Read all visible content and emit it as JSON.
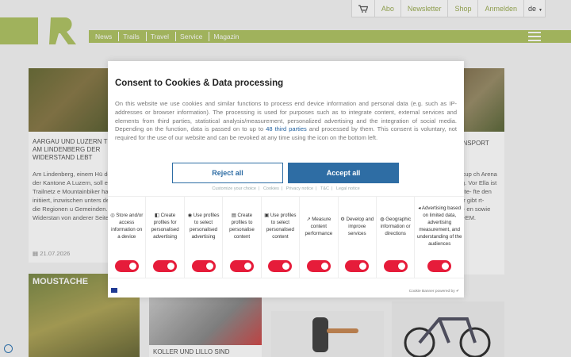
{
  "topbar": {
    "cart_icon": "cart-icon",
    "abo": "Abo",
    "newsletter": "Newsletter",
    "shop": "Shop",
    "login": "Anmelden",
    "lang": "de"
  },
  "nav": {
    "items": [
      "News",
      "Trails",
      "Travel",
      "Service",
      "Magazin"
    ],
    "menu_icon": "hamburger-menu-icon"
  },
  "articles": {
    "a1": {
      "title": "AARGAU UND LUZERN TRAILS AM LINDENBERG DER WIDERSTAND LEBT",
      "text": "Am Lindenberg, einem Hü der Grenze der Kantone A Luzern, soll ein Trailnetz e Mountainbiker haben das initiiert, inzwischen unters der Bund, die Regionen u Gemeinden. Der Widerstan von anderer Seite.",
      "date": "21.07.2026"
    },
    "a2": {
      "title": "BOT NSPORT",
      "text": "-Weltcup ch Arena nnung. Vor Ella ist die Elite- fte den Weiter gibt rt-Track- en sowie athon-EM."
    },
    "a3": {
      "title": "MOUSTACHE"
    },
    "a4": {
      "title": "KOLLER UND LILLO SIND"
    }
  },
  "consent": {
    "title": "Consent to Cookies & Data processing",
    "body_before_link": "On this website we use cookies and similar functions to process end device information and personal data (e.g. such as IP-addresses or browser information). The processing is used for purposes such as to integrate content, external services and elements from third parties, statistical analysis/measurement, personalized advertising and the integration of social media. Depending on the function, data is passed on to up to ",
    "link": "48 third parties",
    "body_after_link": " and processed by them. This consent is voluntary, not required for the use of our website and can be revoked at any time using the icon on the bottom left.",
    "reject": "Reject all",
    "accept": "Accept all",
    "links": [
      "Customize your choice",
      "Cookies",
      "Privacy notice",
      "T&C",
      "Legal notice"
    ],
    "purposes": [
      "Store and/or access information on a device",
      "Create profiles for personalised advertising",
      "Use profiles to select personalised advertising",
      "Create profiles to personalise content",
      "Use profiles to select personalised content",
      "Measure content performance",
      "Develop and improve services",
      "Geographic information or directions",
      "Advertising based on limited data, advertising measurement, and understanding of the audiences"
    ],
    "powered_by": "Cookie Banner powered by"
  },
  "colors": {
    "brand_green": "#b0c466",
    "consent_blue": "#2e6da4",
    "toggle_red": "#e61c3a"
  }
}
